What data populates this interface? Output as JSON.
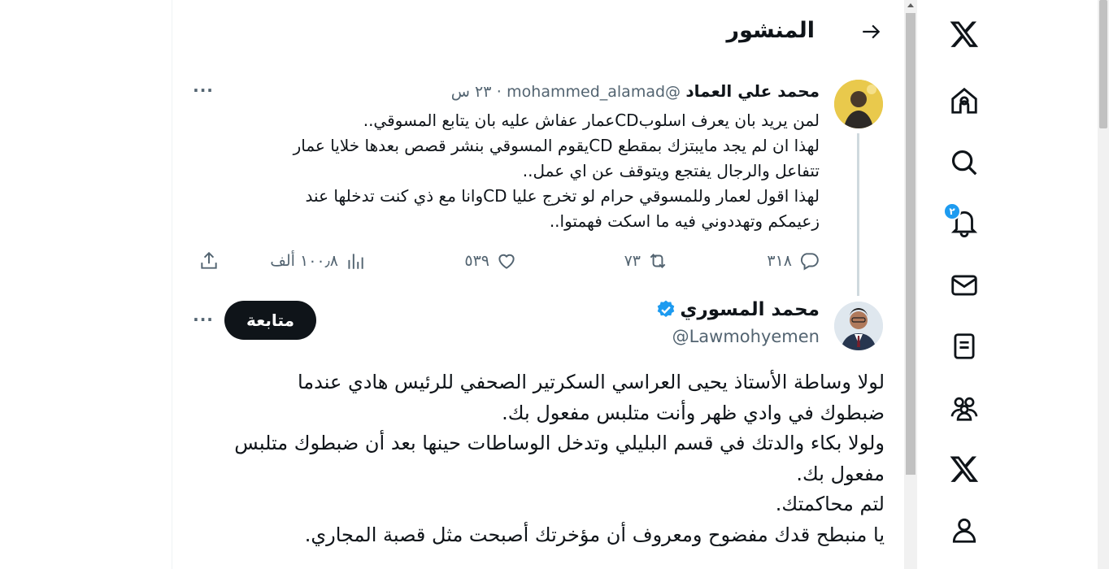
{
  "header": {
    "title": "المنشور"
  },
  "nav": {
    "items": [
      "x-logo",
      "home",
      "explore",
      "notifications",
      "messages",
      "lists",
      "communities",
      "premium",
      "profile"
    ],
    "notifications_badge": "٢"
  },
  "parent_post": {
    "author_name": "محمد علي العماد",
    "handle": "@mohammed_alamad",
    "separator": "·",
    "time": "٢٣ س",
    "lines": [
      "لمن يريد بان يعرف اسلوبCDعمار عفاش عليه بان يتابع  المسوقي..",
      "لهذا ان لم يجد  مايبتزك بمقطع CDيقوم المسوقي بنشر قصص بعدها خلايا عمار",
      "تتفاعل والرجال يفتجع ويتوقف عن اي عمل..",
      "لهذا اقول لعمار وللمسوقي حرام لو تخرج عليا CDوانا مع ذي كنت تدخلها عند",
      "زعيمكم  وتهددوني فيه ما اسكت فهمتوا.."
    ],
    "stats": {
      "replies": "٣١٨",
      "reposts": "٧٣",
      "likes": "٥٣٩",
      "views": "١٠٠٫٨ ألف"
    }
  },
  "main_post": {
    "author_name": "محمد المسوري",
    "handle": "@Lawmohyemen",
    "follow_label": "متابعة",
    "lines": [
      "لولا وساطة الأستاذ يحيى العراسي السكرتير الصحفي للرئيس هادي عندما",
      "ضبطوك في وادي ظهر وأنت متلبس مفعول بك.",
      "ولولا بكاء والدتك في قسم البليلي وتدخل الوساطات حينها بعد أن ضبطوك متلبس",
      "مفعول بك.",
      "لتم محاكمتك.",
      "يا منبطح قدك مفضوح ومعروف أن مؤخرتك أصبحت مثل قصبة المجاري."
    ]
  },
  "colors": {
    "accent": "#1d9bf0",
    "text": "#0f1419",
    "muted": "#536471"
  }
}
